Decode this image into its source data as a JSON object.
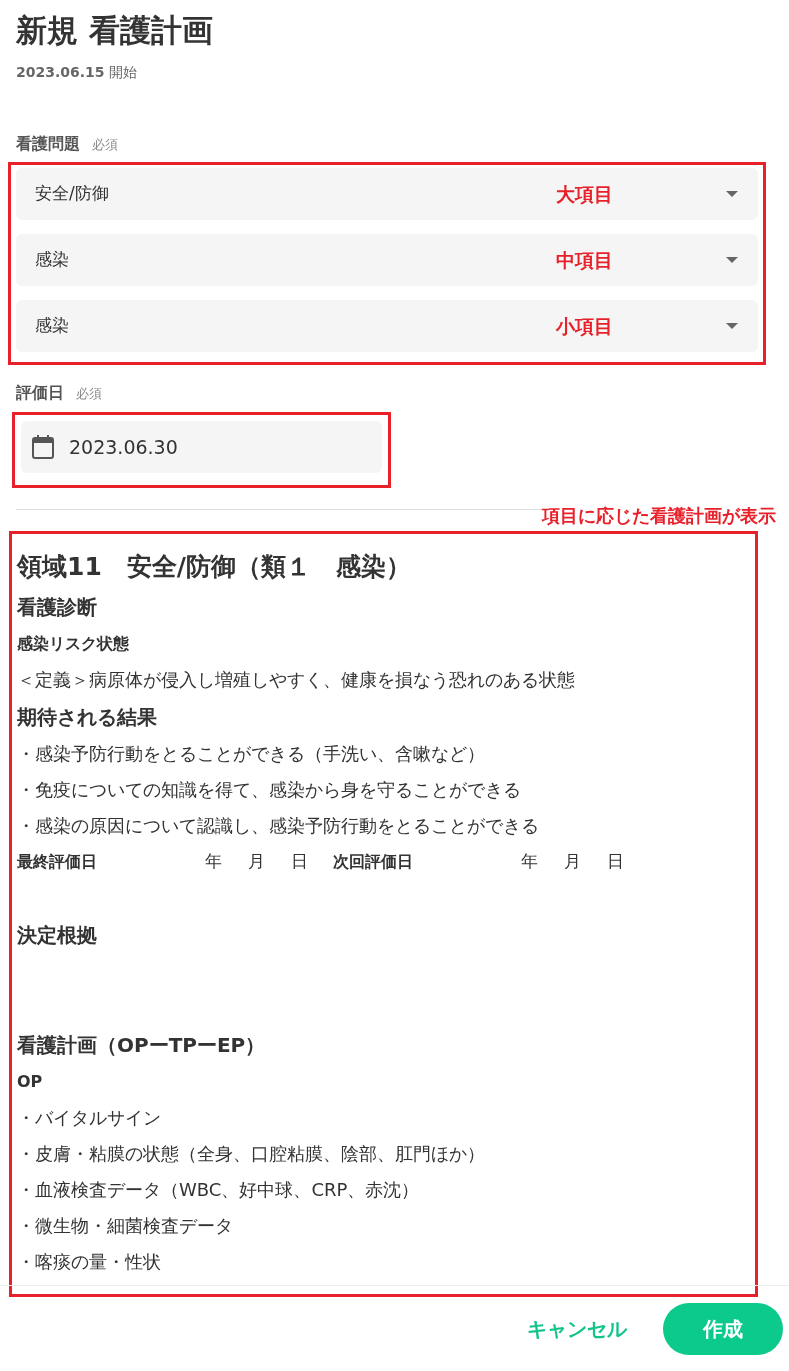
{
  "title": "新規 看護計画",
  "start": {
    "date": "2023.06.15",
    "label": "開始"
  },
  "problem": {
    "label": "看護問題",
    "required": "必須",
    "selects": [
      {
        "value": "安全/防御",
        "annotation": "大項目"
      },
      {
        "value": "感染",
        "annotation": "中項目"
      },
      {
        "value": "感染",
        "annotation": "小項目"
      }
    ]
  },
  "eval_date": {
    "label": "評価日",
    "required": "必須",
    "value": "2023.06.30"
  },
  "plan_annotation": "項目に応じた看護計画が表示",
  "plan": [
    {
      "kind": "h1",
      "text": "領域11　安全/防御（類１　感染）"
    },
    {
      "kind": "h2",
      "text": "看護診断"
    },
    {
      "kind": "h3",
      "text": "感染リスク状態"
    },
    {
      "kind": "p",
      "text": "＜定義＞病原体が侵入し増殖しやすく、健康を損なう恐れのある状態"
    },
    {
      "kind": "h2",
      "text": "期待される結果"
    },
    {
      "kind": "p",
      "text": "・感染予防行動をとることができる（手洗い、含嗽など）"
    },
    {
      "kind": "p",
      "text": "・免疫についての知識を得て、感染から身を守ることができる"
    },
    {
      "kind": "p",
      "text": "・感染の原因について認識し、感染予防行動をとることができる"
    },
    {
      "kind": "dates",
      "cells": [
        {
          "label": "最終評価日",
          "parts": [
            "年",
            "月",
            "日"
          ]
        },
        {
          "label": "次回評価日",
          "parts": [
            "年",
            "月",
            "日"
          ]
        }
      ]
    },
    {
      "kind": "gap"
    },
    {
      "kind": "h2",
      "text": "決定根拠"
    },
    {
      "kind": "gap"
    },
    {
      "kind": "gap"
    },
    {
      "kind": "h2",
      "text": "看護計画（OPーTPーEP）"
    },
    {
      "kind": "h3",
      "text": "OP"
    },
    {
      "kind": "p",
      "text": "・バイタルサイン"
    },
    {
      "kind": "p",
      "text": "・皮膚・粘膜の状態（全身、口腔粘膜、陰部、肛門ほか）"
    },
    {
      "kind": "p",
      "text": "・血液検査データ（WBC、好中球、CRP、赤沈）"
    },
    {
      "kind": "p",
      "text": "・微生物・細菌検査データ"
    },
    {
      "kind": "p",
      "text": "・喀痰の量・性状"
    }
  ],
  "buttons": {
    "cancel": "キャンセル",
    "create": "作成"
  }
}
